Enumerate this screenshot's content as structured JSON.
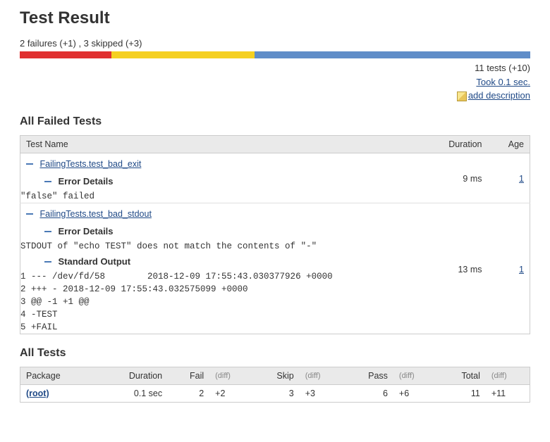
{
  "title": "Test Result",
  "summary_line": "2 failures (+1) , 3 skipped (+3)",
  "bar": {
    "red_pct": 18,
    "yellow_pct": 28,
    "blue_pct": 54
  },
  "meta": {
    "tests_line": "11 tests (+10)",
    "took_line": "Took 0.1 sec.",
    "add_desc": "add description"
  },
  "failed_section": {
    "heading": "All Failed Tests",
    "columns": {
      "name": "Test Name",
      "duration": "Duration",
      "age": "Age"
    },
    "tests": [
      {
        "name": "FailingTests.test_bad_exit",
        "duration": "9 ms",
        "age": "1",
        "error_heading": "Error Details",
        "error_body": "\"false\" failed"
      },
      {
        "name": "FailingTests.test_bad_stdout",
        "duration": "13 ms",
        "age": "1",
        "error_heading": "Error Details",
        "error_body": "STDOUT of \"echo TEST\" does not match the contents of \"-\"",
        "stdout_heading": "Standard Output",
        "stdout_lines": [
          "1 --- /dev/fd/58        2018-12-09 17:55:43.030377926 +0000",
          "2 +++ - 2018-12-09 17:55:43.032575099 +0000",
          "3 @@ -1 +1 @@",
          "4 -TEST",
          "5 +FAIL"
        ]
      }
    ]
  },
  "all_tests": {
    "heading": "All Tests",
    "columns": {
      "package": "Package",
      "duration": "Duration",
      "fail": "Fail",
      "skip": "Skip",
      "pass": "Pass",
      "total": "Total",
      "diff": "(diff)"
    },
    "rows": [
      {
        "package": "(root)",
        "duration": "0.1 sec",
        "fail": "2",
        "fail_diff": "+2",
        "skip": "3",
        "skip_diff": "+3",
        "pass": "6",
        "pass_diff": "+6",
        "total": "11",
        "total_diff": "+11"
      }
    ]
  }
}
